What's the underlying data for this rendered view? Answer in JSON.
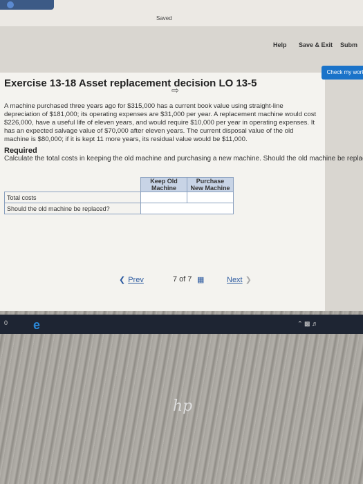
{
  "top": {
    "saved_label": "Saved",
    "help": "Help",
    "save_exit": "Save & Exit",
    "submit": "Subm",
    "check_work": "Check my work"
  },
  "exercise": {
    "title": "Exercise 13-18 Asset replacement decision LO 13-5",
    "paragraph": "A machine purchased three years ago for $315,000 has a current book value using straight-line depreciation of $181,000; its operating expenses are $31,000 per year. A replacement machine would cost $226,000, have a useful life of eleven years, and would require $10,000 per year in operating expenses. It has an expected salvage value of $70,000 after eleven years. The current disposal value of the old machine is $80,000; if it is kept 11 more years, its residual value would be $11,000.",
    "required_heading": "Required",
    "required_text": "Calculate the total costs in keeping the old machine and purchasing a new machine. Should the old machine be replaced?"
  },
  "table": {
    "col1": "Keep Old Machine",
    "col2": "Purchase New Machine",
    "row1": "Total costs",
    "row2": "Should the old machine be replaced?",
    "row1_keep": "",
    "row1_new": "",
    "row2_answer": ""
  },
  "nav": {
    "prev": "Prev",
    "page": "7 of 7",
    "next": "Next"
  },
  "taskbar": {
    "start": "0"
  }
}
